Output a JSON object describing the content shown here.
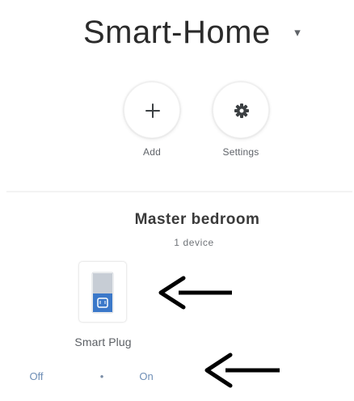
{
  "home": {
    "title": "Smart-Home",
    "dropdown_icon": "▾"
  },
  "actions": {
    "add": {
      "label": "Add",
      "icon": "plus-icon"
    },
    "settings": {
      "label": "Settings",
      "icon": "gear-icon"
    }
  },
  "room": {
    "name": "Master bedroom",
    "device_count": "1 device"
  },
  "device": {
    "name": "Smart Plug",
    "icon": "smart-plug-icon",
    "off_label": "Off",
    "separator": "•",
    "on_label": "On"
  },
  "annotations": {
    "arrow_icon": "left-arrow-icon"
  },
  "colors": {
    "accent_blue": "#3b78c9",
    "text_dark": "#2b2b2b",
    "text_muted": "#6f7378"
  }
}
